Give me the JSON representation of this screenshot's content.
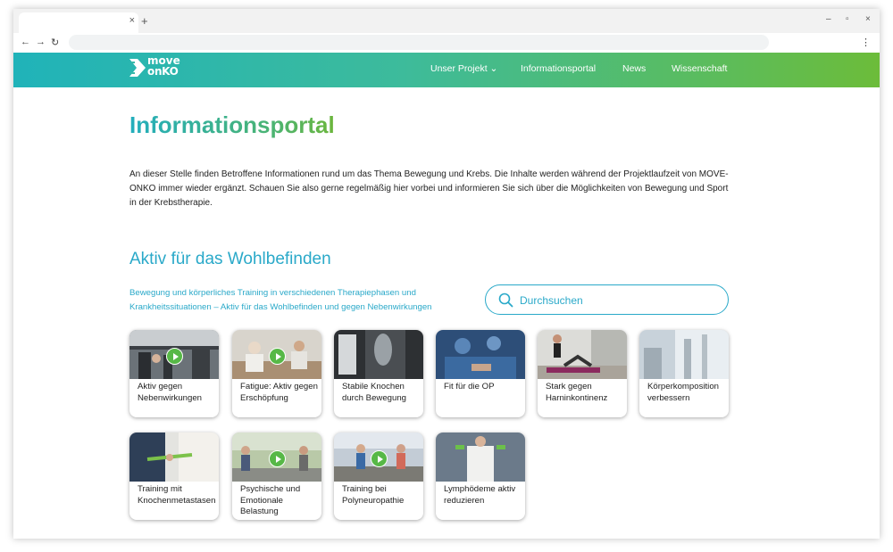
{
  "browser": {
    "tab_close": "×",
    "new_tab": "+",
    "minimize": "–",
    "maximize": "▫",
    "close": "×",
    "back": "←",
    "forward": "→",
    "reload": "↻",
    "menu": "⋮"
  },
  "site": {
    "logo_line1": "move",
    "logo_line2": "onKO",
    "nav": [
      {
        "label": "Unser Projekt ⌄"
      },
      {
        "label": "Informationsportal"
      },
      {
        "label": "News"
      },
      {
        "label": "Wissenschaft"
      }
    ],
    "gradient_start": "#20b3b9",
    "gradient_end": "#6cbc3a"
  },
  "main": {
    "title": "Informationsportal",
    "intro": "An dieser Stelle finden Betroffene Informationen rund um das Thema Bewegung und Krebs. Die Inhalte werden während der Projektlaufzeit von MOVE-ONKO immer wieder ergänzt. Schauen Sie also gerne regelmäßig hier vorbei und informieren Sie sich über die Möglichkeiten von Bewegung und Sport in der Krebstherapie.",
    "section_title": "Aktiv für das Wohlbefinden",
    "section_desc": "Bewegung und körperliches Training in verschiedenen Therapiephasen und Krankheitssituationen – Aktiv für das Wohlbefinden und gegen Nebenwirkungen",
    "search_placeholder": "Durchsuchen",
    "accent_color": "#2aa9c9"
  },
  "cards": [
    {
      "label": "Aktiv gegen Nebenwirkungen",
      "video": true,
      "image": "gym-training"
    },
    {
      "label": "Fatigue: Aktiv gegen Erschöpfung",
      "video": true,
      "image": "consultation"
    },
    {
      "label": "Stabile Knochen durch Bewegung",
      "video": false,
      "image": "x-ray"
    },
    {
      "label": "Fit für die OP",
      "video": false,
      "image": "surgery"
    },
    {
      "label": "Stark gegen Harninkontinenz",
      "video": false,
      "image": "pelvic-exercise"
    },
    {
      "label": "Körperkomposition verbessern",
      "video": false,
      "image": "measurement-device"
    },
    {
      "label": "Training mit Knochenmetastasen",
      "video": false,
      "image": "resistance-band"
    },
    {
      "label": "Psychische und Emotionale Belastung",
      "video": true,
      "image": "group-outdoor"
    },
    {
      "label": "Training bei Polyneuropathie",
      "video": true,
      "image": "walking-group"
    },
    {
      "label": "Lymphödeme aktiv reduzieren",
      "video": false,
      "image": "dumbbells"
    }
  ]
}
